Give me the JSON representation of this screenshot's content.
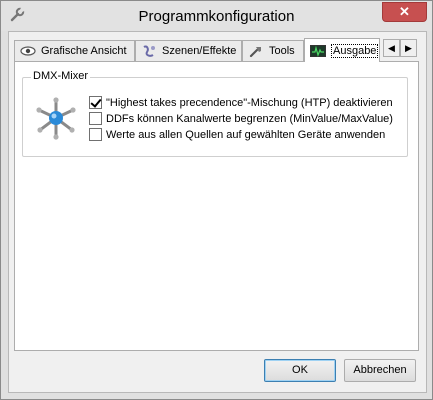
{
  "window": {
    "title": "Programmkonfiguration",
    "close_glyph": "✕"
  },
  "tabs": [
    {
      "label": "Grafische Ansicht",
      "icon": "eye-icon"
    },
    {
      "label": "Szenen/Effekte",
      "icon": "scenes-icon"
    },
    {
      "label": "Tools",
      "icon": "tools-icon"
    },
    {
      "label": "Ausgabe",
      "icon": "output-icon",
      "active": true
    }
  ],
  "tab_scroll": {
    "left": "◀",
    "right": "▶"
  },
  "group": {
    "title": "DMX-Mixer",
    "icon": "dmx-mixer-icon",
    "options": [
      {
        "label": "\"Highest takes precendence\"-Mischung (HTP) deaktivieren",
        "checked": true
      },
      {
        "label": "DDFs können Kanalwerte begrenzen (MinValue/MaxValue)",
        "checked": false
      },
      {
        "label": "Werte aus allen Quellen auf gewählten Geräte anwenden",
        "checked": false
      }
    ]
  },
  "buttons": {
    "ok": "OK",
    "cancel": "Abbrechen"
  },
  "colors": {
    "accent": "#2a8ad8",
    "close": "#c75050"
  }
}
